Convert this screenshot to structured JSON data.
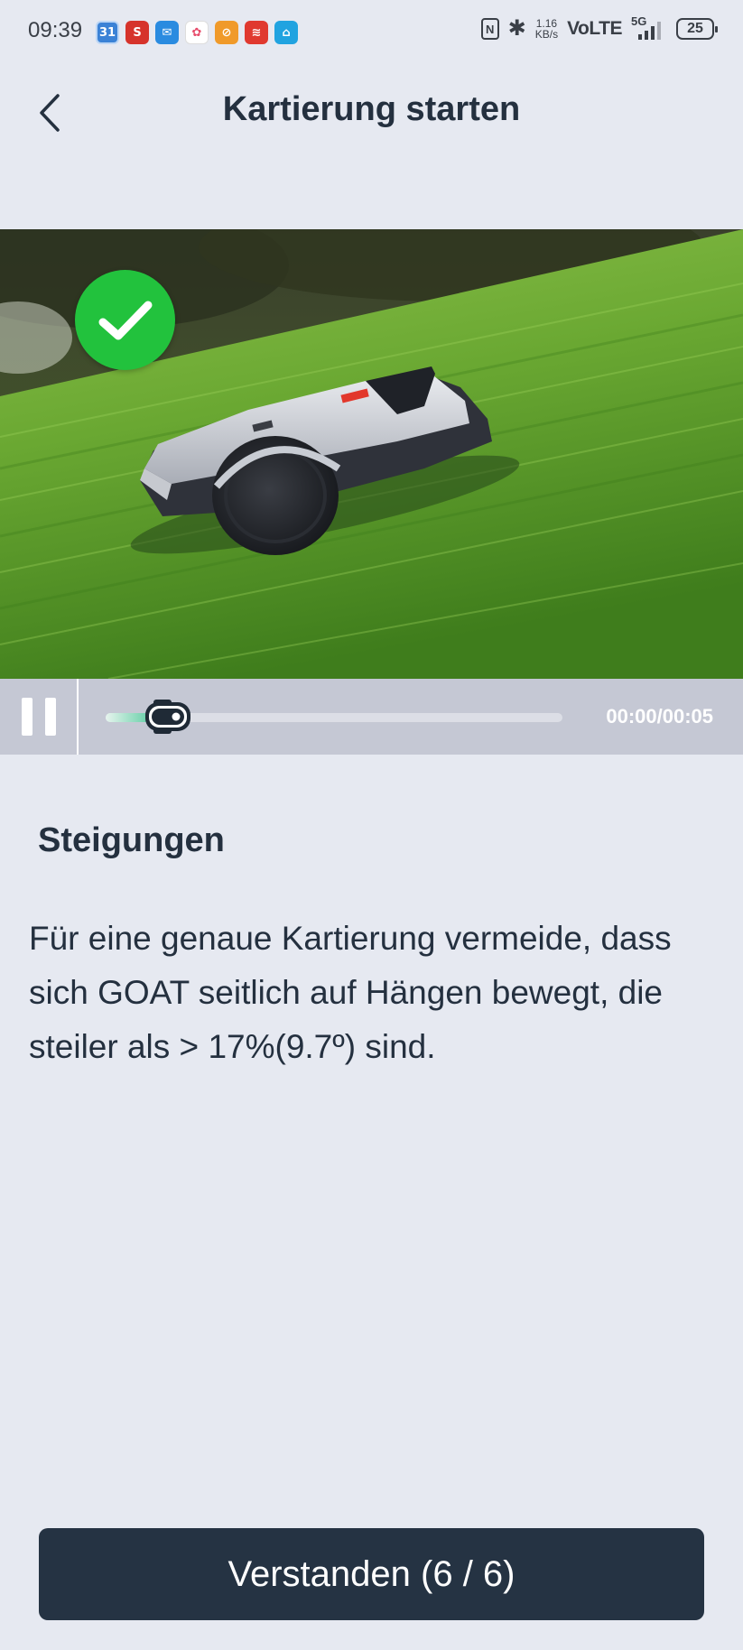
{
  "status_bar": {
    "time": "09:39",
    "notification_icons": [
      {
        "name": "calendar-app-icon",
        "label": "31",
        "color": "#3b82d6"
      },
      {
        "name": "s-app-icon",
        "label": "S",
        "color": "#d6332b"
      },
      {
        "name": "mail-app-icon",
        "label": "✉",
        "color": "#2a8be0"
      },
      {
        "name": "flower-app-icon",
        "label": "✿",
        "color": "#ffffff"
      },
      {
        "name": "link-app-icon",
        "label": "⊘",
        "color": "#f09a2a"
      },
      {
        "name": "red-app-icon",
        "label": "≋",
        "color": "#e0392f"
      },
      {
        "name": "home-app-icon",
        "label": "⌂",
        "color": "#21a3e0"
      }
    ],
    "nfc": "N",
    "bluetooth": "✱",
    "net_speed_value": "1.16",
    "net_speed_unit": "KB/s",
    "volte": "VoLTE",
    "network": "5G",
    "battery": "25"
  },
  "header": {
    "title": "Kartierung starten",
    "back_icon": "chevron-left-icon"
  },
  "video": {
    "status_icon": "checkmark-icon",
    "status_color": "#22c23d",
    "progress": 0.13,
    "time": "00:00/00:05"
  },
  "content": {
    "section_title": "Steigungen",
    "body": "Für eine genaue Kartierung vermeide, dass sich GOAT seitlich auf Hängen bewegt, die steiler als > 17%(9.7º) sind."
  },
  "footer": {
    "button_label": "Verstanden (6 / 6)"
  },
  "colors": {
    "background": "#e6e9f1",
    "primary_dark": "#253343",
    "controls_bar": "#c5c8d4",
    "progress_accent": "#39c28f"
  }
}
